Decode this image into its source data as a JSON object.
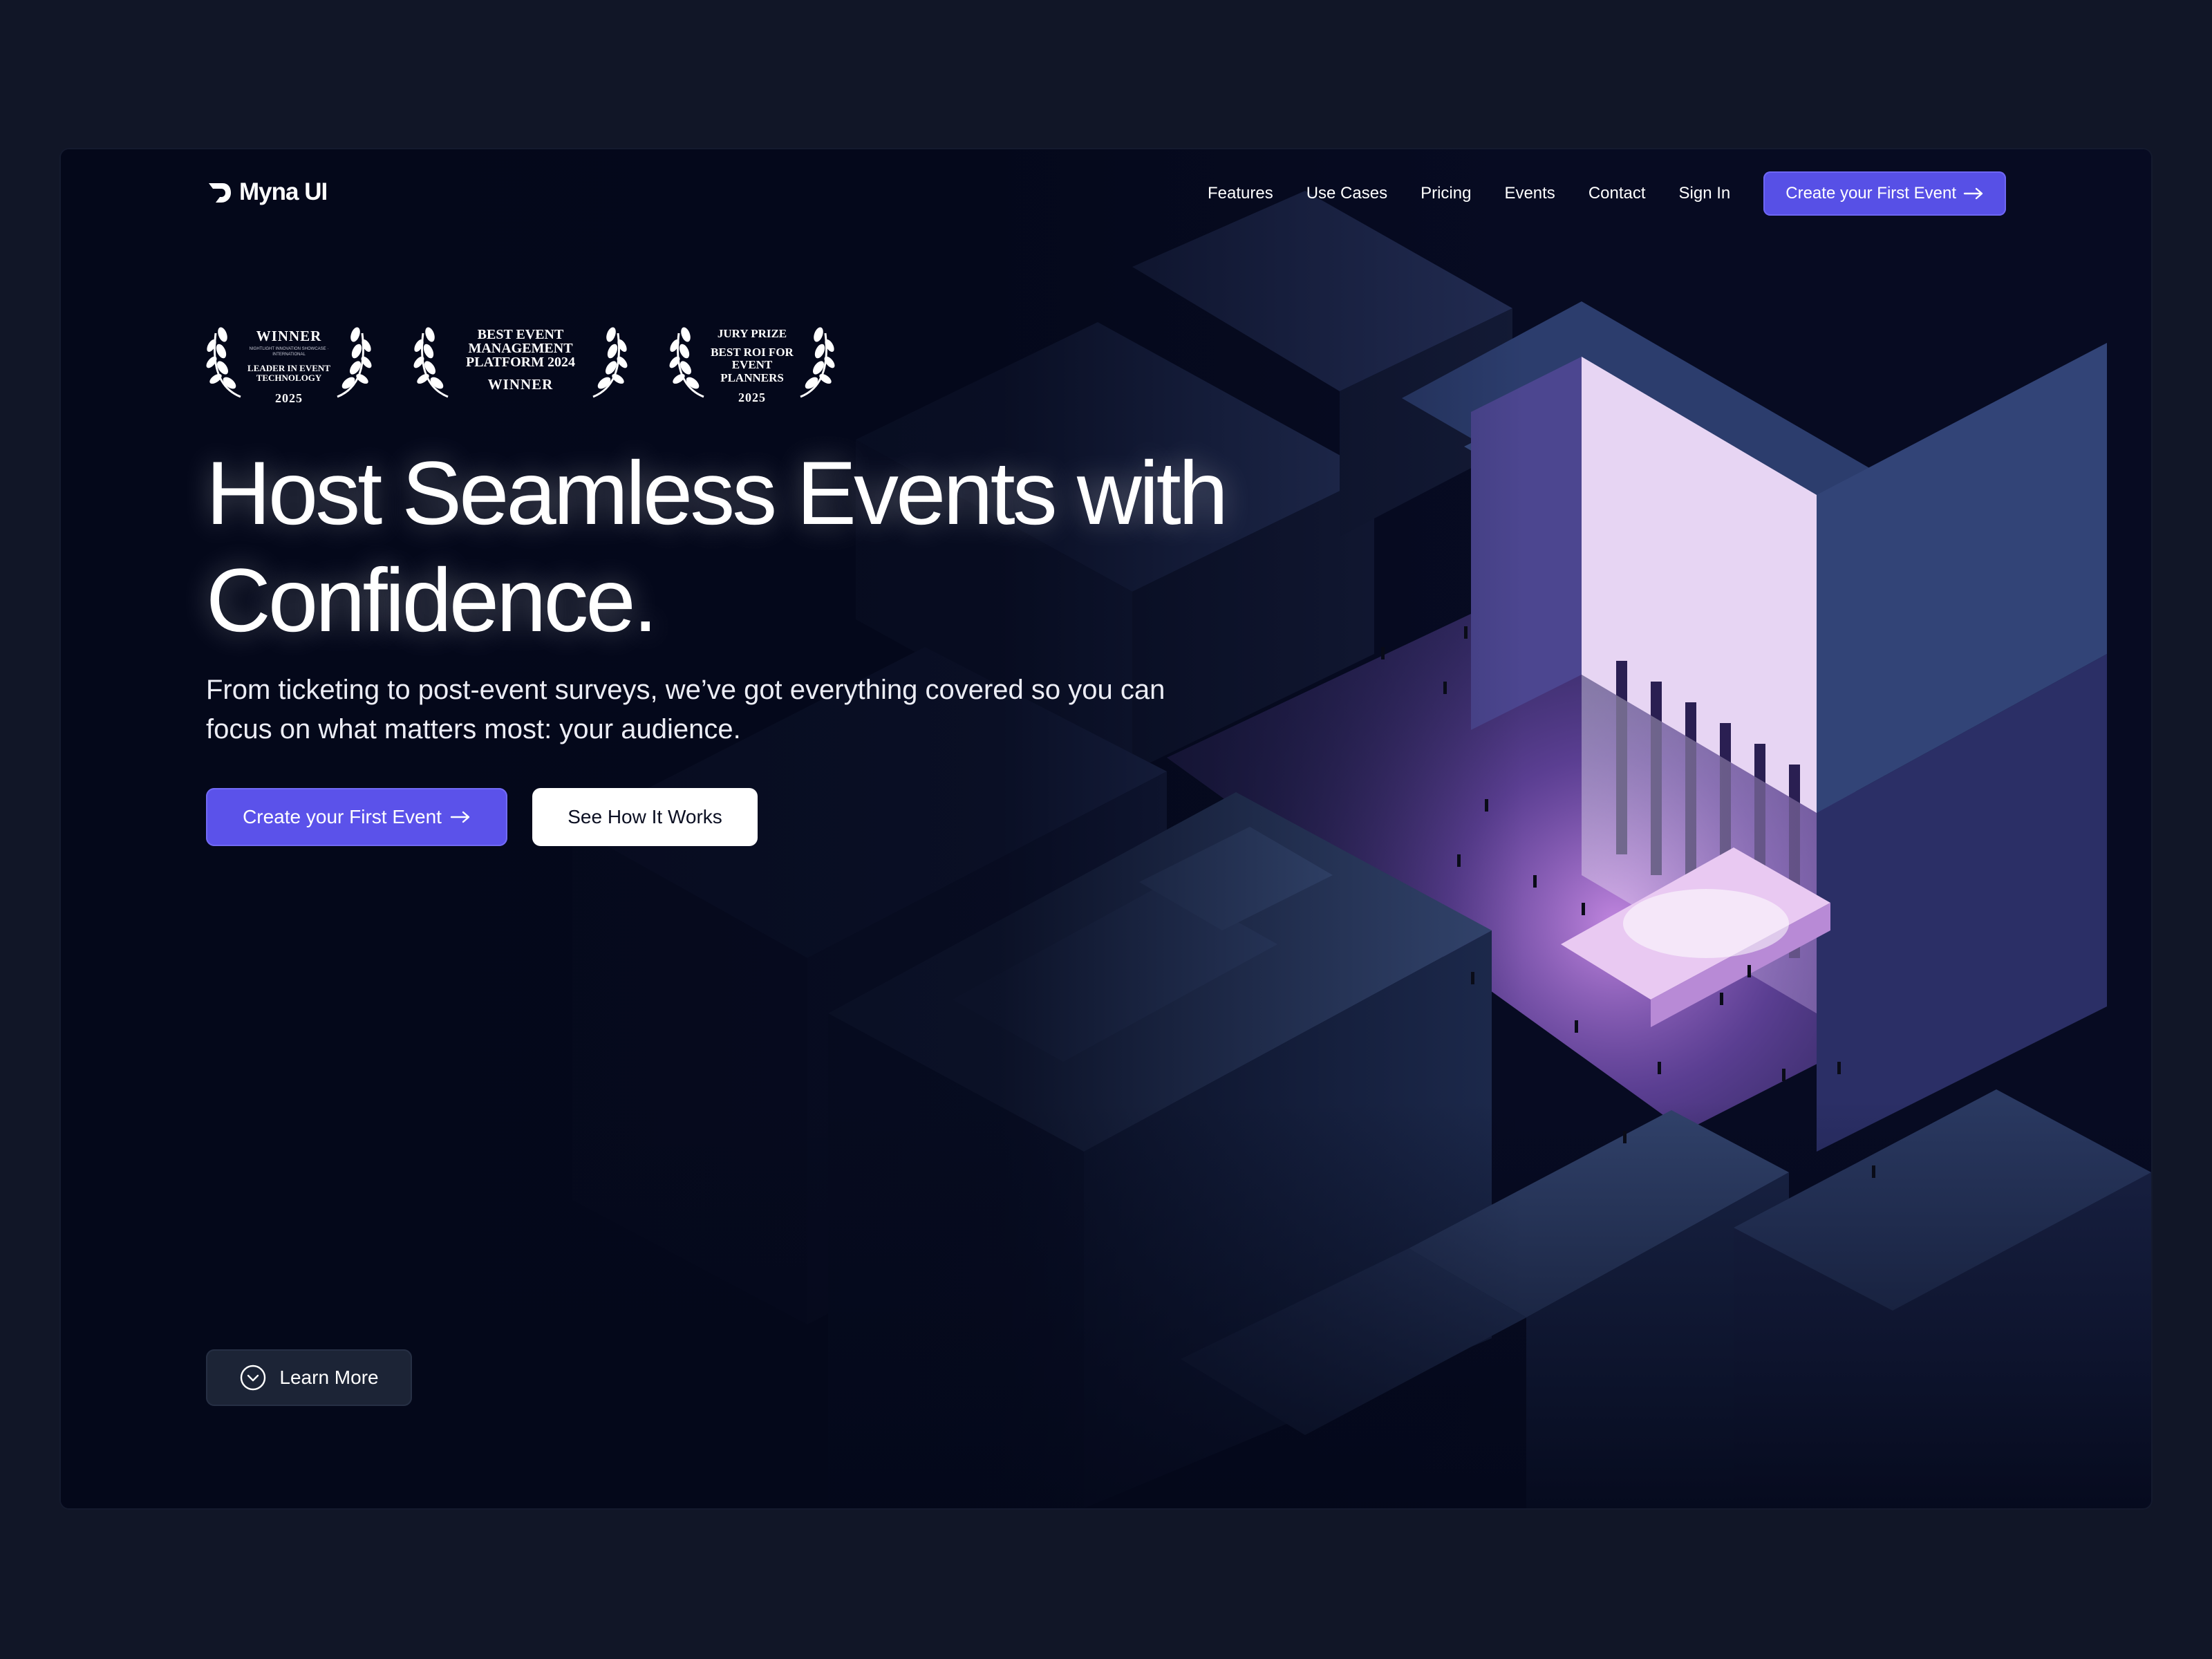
{
  "brand": {
    "name": "Myna UI",
    "accent": "#5b52ea",
    "background": "#04081a"
  },
  "nav": {
    "links": [
      "Features",
      "Use Cases",
      "Pricing",
      "Events",
      "Contact",
      "Sign In"
    ],
    "cta_label": "Create your First Event"
  },
  "awards": [
    {
      "title": "WINNER",
      "fine_print": "NIGHTLIGHT INNOVATION SHOWCASE · INTERNATIONAL",
      "category": "LEADER IN EVENT TECHNOLOGY",
      "year": "2025"
    },
    {
      "heading": "BEST EVENT MANAGEMENT PLATFORM 2024",
      "label": "WINNER"
    },
    {
      "title": "JURY PRIZE",
      "category": "BEST ROI FOR EVENT PLANNERS",
      "year": "2025"
    }
  ],
  "hero": {
    "headline": "Host Seamless Events with Confidence.",
    "subtext": "From ticketing to post-event surveys, we’ve got everything covered so you can focus on what matters most: your audience.",
    "primary_cta": "Create your First Event",
    "secondary_cta": "See How It Works"
  },
  "learn_more": {
    "label": "Learn More",
    "icon": "chevron-down-circle-icon"
  },
  "icons": {
    "arrow": "arrow-right-icon",
    "laurel": "laurel-wreath-icon",
    "logo": "myna-logo-icon"
  }
}
